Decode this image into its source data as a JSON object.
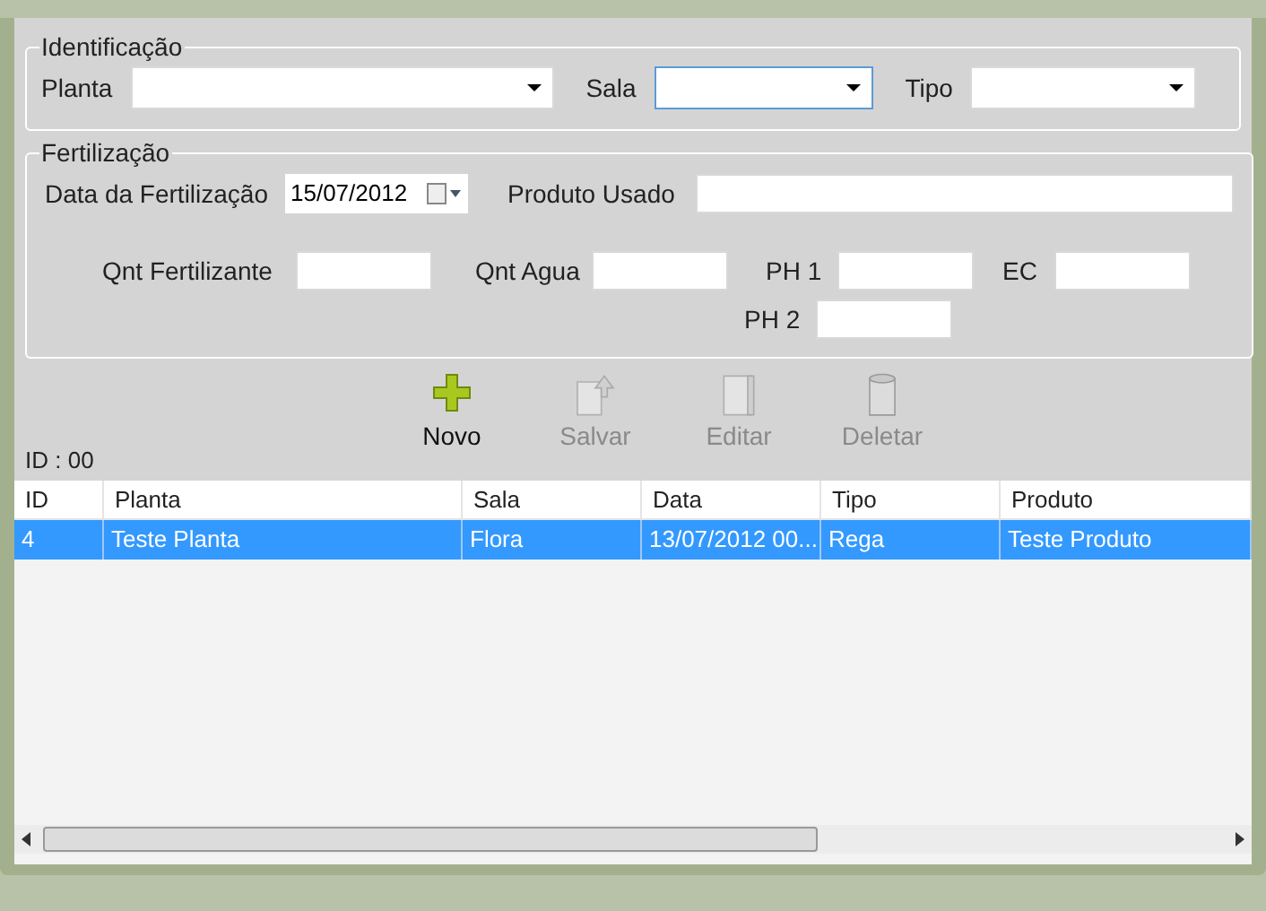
{
  "identificacao": {
    "title": "Identificação",
    "fields": [
      {
        "label": "Planta",
        "focused": false
      },
      {
        "label": "Sala",
        "focused": true
      },
      {
        "label": "Tipo",
        "focused": false
      }
    ]
  },
  "fertilizacao": {
    "title": "Fertilização",
    "data_label": "Data da Fertilização",
    "data_value": "15/07/2012",
    "produto_label": "Produto Usado",
    "qnt_fertilizante_label": "Qnt Fertilizante",
    "qnt_agua_label": "Qnt Agua",
    "ph1_label": "PH 1",
    "ec_label": "EC",
    "ph2_label": "PH 2"
  },
  "id_label": "ID : 00",
  "toolbar": [
    {
      "label": "Novo",
      "kind": "plus",
      "disabled": false
    },
    {
      "label": "Salvar",
      "kind": "save",
      "disabled": true
    },
    {
      "label": "Editar",
      "kind": "edit",
      "disabled": true
    },
    {
      "label": "Deletar",
      "kind": "delete",
      "disabled": true
    }
  ],
  "table": {
    "columns": [
      "ID",
      "Planta",
      "Sala",
      "Data",
      "Tipo",
      "Produto"
    ],
    "rows": [
      {
        "cells": [
          "4",
          "Teste Planta",
          "Flora",
          "13/07/2012 00...",
          "Rega",
          "Teste Produto"
        ],
        "selected": true
      }
    ]
  }
}
